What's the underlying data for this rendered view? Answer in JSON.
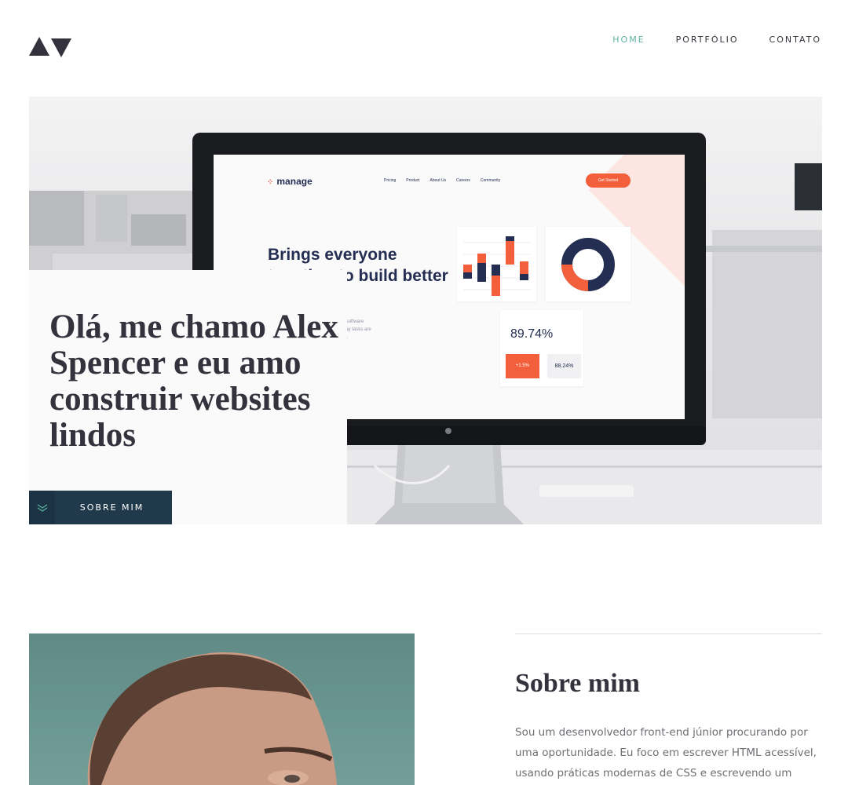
{
  "header": {
    "nav": [
      {
        "label": "HOME",
        "active": true
      },
      {
        "label": "PORTFÓLIO",
        "active": false
      },
      {
        "label": "CONTATO",
        "active": false
      }
    ]
  },
  "hero": {
    "title": "Olá, me chamo Alex Spencer e eu amo construir websites lindos",
    "button_label": "SOBRE MIM",
    "mockup": {
      "brand": "manage",
      "nav": [
        "Pricing",
        "Product",
        "About Us",
        "Careers",
        "Community"
      ],
      "cta": "Get Started",
      "headline": "Brings everyone together to build better products.",
      "subtext": "r software\nday tasks are\nal.",
      "stat_main": "89.74%",
      "stat_badge": "+1.5%",
      "stat_secondary": "88.24%"
    }
  },
  "about": {
    "title": "Sobre mim",
    "text": "Sou um desenvolvedor front-end júnior procurando por uma oportunidade. Eu foco em escrever HTML acessível, usando práticas modernas de CSS e escrevendo um"
  },
  "colors": {
    "accent": "#5fb4a2",
    "dark": "#33323d",
    "button": "#203a4c",
    "mockup_orange": "#f25f3a",
    "mockup_navy": "#242d52"
  }
}
